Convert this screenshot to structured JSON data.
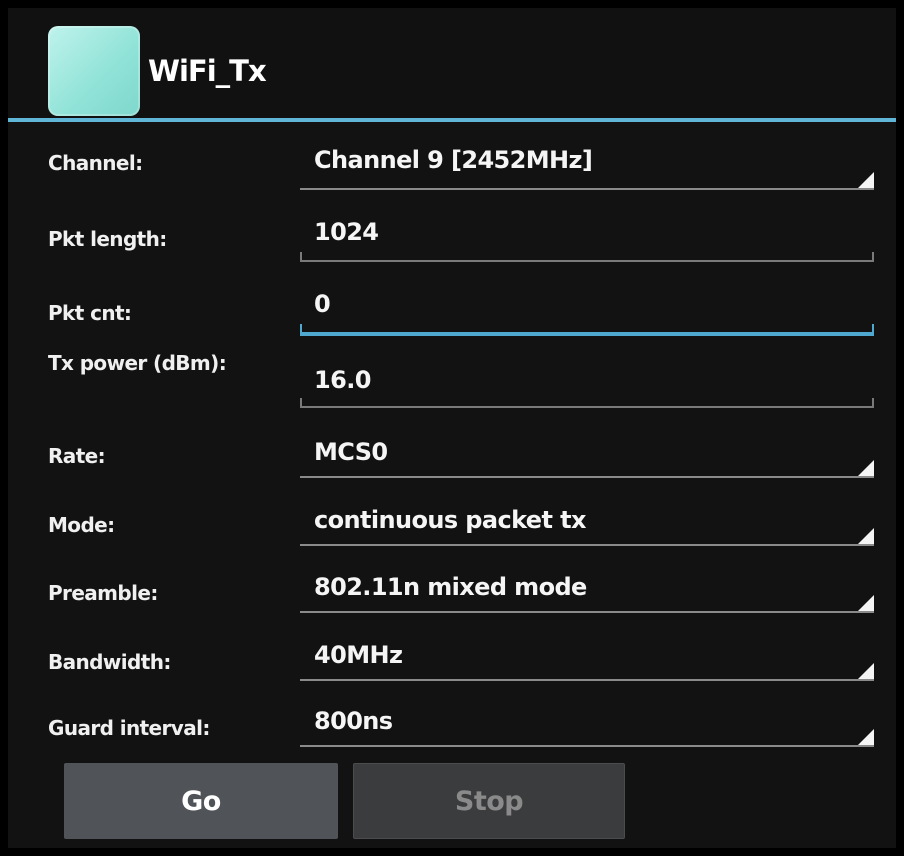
{
  "app": {
    "title": "WiFi_Tx",
    "icon": "app-icon"
  },
  "form": {
    "channel": {
      "label": "Channel:",
      "value": "Channel 9 [2452MHz]"
    },
    "pkt_length": {
      "label": "Pkt length:",
      "value": "1024"
    },
    "pkt_cnt": {
      "label": "Pkt cnt:",
      "value": "0"
    },
    "tx_power": {
      "label": "Tx power (dBm):",
      "value": "16.0"
    },
    "rate": {
      "label": "Rate:",
      "value": "MCS0"
    },
    "mode": {
      "label": "Mode:",
      "value": "continuous packet tx"
    },
    "preamble": {
      "label": "Preamble:",
      "value": "802.11n mixed mode"
    },
    "bandwidth": {
      "label": "Bandwidth:",
      "value": "40MHz"
    },
    "guard_interval": {
      "label": "Guard interval:",
      "value": "800ns"
    }
  },
  "buttons": {
    "go": "Go",
    "stop": "Stop"
  },
  "colors": {
    "accent": "#5fb6d6",
    "background": "#121212",
    "go_button": "#505458",
    "stop_button_disabled": "#3a3c3e"
  }
}
